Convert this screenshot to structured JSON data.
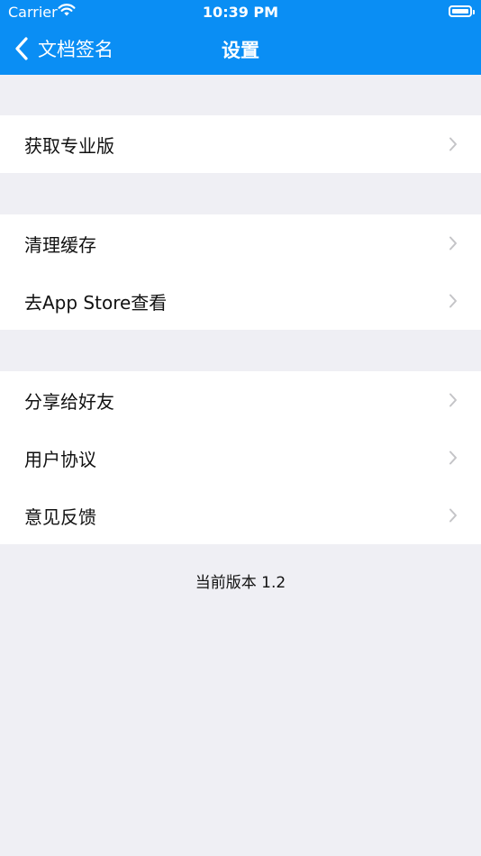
{
  "status_bar": {
    "carrier": "Carrier",
    "time": "10:39 PM"
  },
  "nav": {
    "back_label": "文档签名",
    "title": "设置"
  },
  "groups": [
    {
      "items": [
        {
          "label": "获取专业版"
        }
      ]
    },
    {
      "items": [
        {
          "label": "清理缓存"
        },
        {
          "label": "去App Store查看"
        }
      ]
    },
    {
      "items": [
        {
          "label": "分享给好友"
        },
        {
          "label": "用户协议"
        },
        {
          "label": "意见反馈"
        }
      ]
    }
  ],
  "footer": {
    "version_text": "当前版本 1.2"
  },
  "colors": {
    "accent": "#0a8ef4",
    "background": "#efeff4",
    "chevron": "#c4c4c7"
  },
  "icons": {
    "back": "chevron-left-icon",
    "row_arrow": "chevron-right-icon",
    "wifi": "wifi-icon",
    "battery": "battery-icon"
  }
}
